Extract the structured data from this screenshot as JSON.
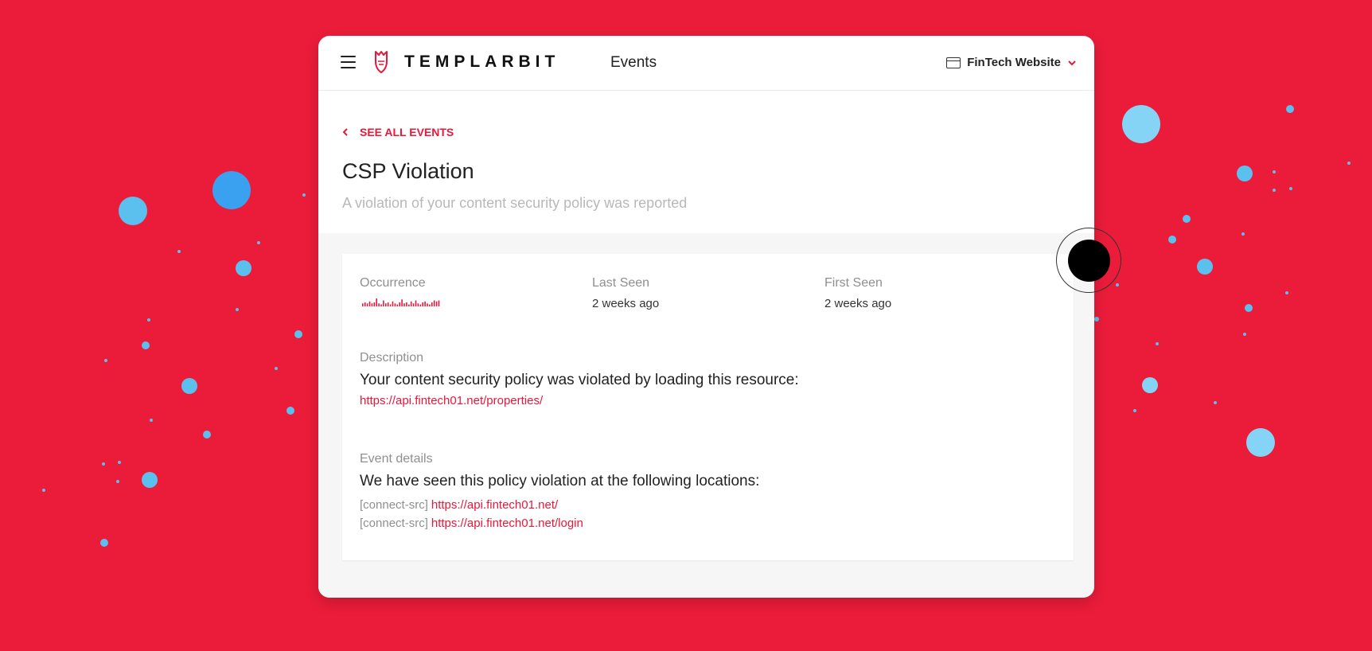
{
  "colors": {
    "background": "#eb1c3a",
    "accent": "#e8183a",
    "dot_light": "#86d4f5",
    "dot_mid": "#5cc0ef",
    "dot_dark": "#3aa0f0"
  },
  "topbar": {
    "menu_icon": "hamburger-icon",
    "logo_text": "TEMPLARBIT",
    "nav_title": "Events",
    "site_icon": "browser-window-icon",
    "site_name": "FinTech Website",
    "site_chevron_icon": "chevron-down-icon"
  },
  "header": {
    "back_label": "SEE ALL EVENTS",
    "title": "CSP Violation",
    "subtitle": "A violation of your content security policy was reported"
  },
  "stats": {
    "occurrence_label": "Occurrence",
    "last_seen_label": "Last Seen",
    "last_seen_value": "2 weeks ago",
    "first_seen_label": "First Seen",
    "first_seen_value": "2 weeks ago",
    "sparkline_values": [
      3,
      4,
      3,
      5,
      3,
      4,
      8,
      3,
      2,
      6,
      3,
      4,
      2,
      5,
      3,
      2,
      4,
      7,
      3,
      4,
      2,
      5,
      3,
      6,
      3,
      2,
      4,
      5,
      3,
      2,
      4,
      6,
      5,
      6
    ]
  },
  "description": {
    "label": "Description",
    "text": "Your content security policy was violated by loading this resource:",
    "resource_url": "https://api.fintech01.net/properties/"
  },
  "event_details": {
    "label": "Event details",
    "text": "We have seen this policy violation at the following locations:",
    "locations": [
      {
        "directive": "[connect-src]",
        "url": "https://api.fintech01.net/"
      },
      {
        "directive": "[connect-src]",
        "url": "https://api.fintech01.net/login"
      }
    ]
  }
}
